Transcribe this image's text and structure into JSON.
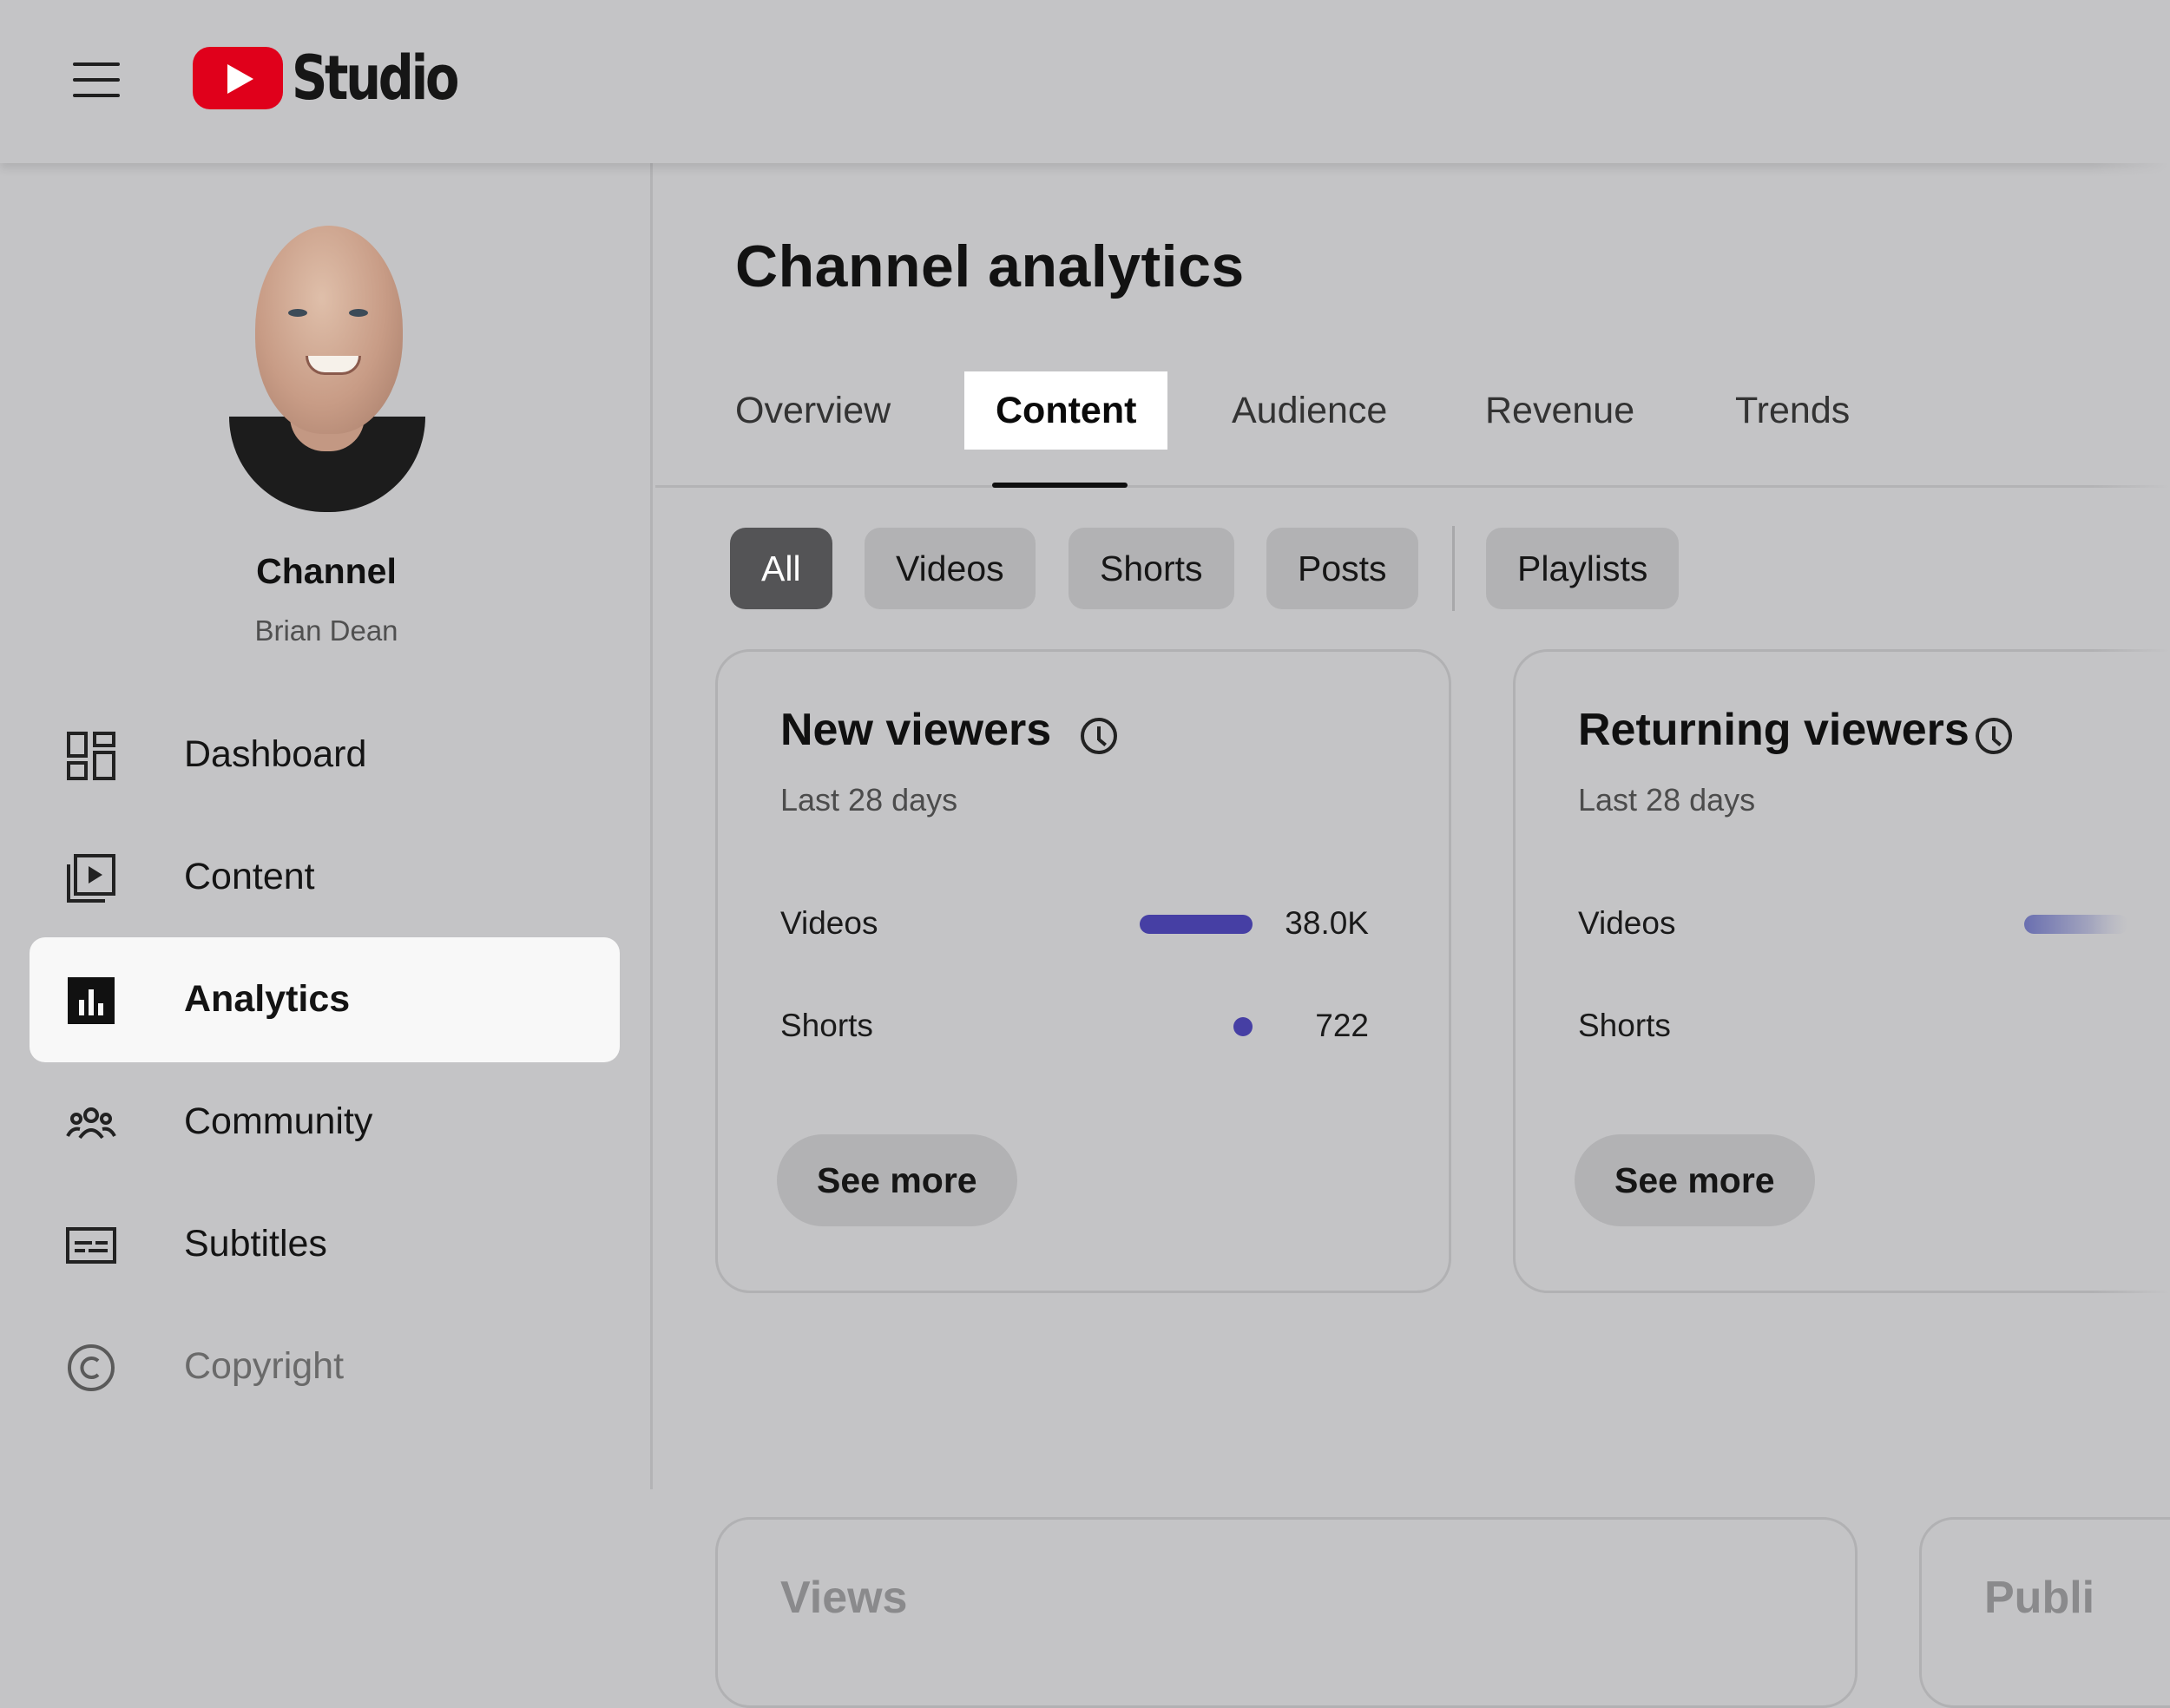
{
  "header": {
    "logo_text": "Studio",
    "logo_icon": "youtube-play-icon",
    "menu_icon": "hamburger-icon"
  },
  "sidebar": {
    "channel_title": "Channel",
    "channel_name": "Brian Dean",
    "items": [
      {
        "label": "Dashboard",
        "icon": "dashboard-icon"
      },
      {
        "label": "Content",
        "icon": "content-icon"
      },
      {
        "label": "Analytics",
        "icon": "analytics-icon",
        "active": true
      },
      {
        "label": "Community",
        "icon": "community-icon"
      },
      {
        "label": "Subtitles",
        "icon": "subtitles-icon"
      },
      {
        "label": "Copyright",
        "icon": "copyright-icon"
      }
    ]
  },
  "main": {
    "title": "Channel analytics",
    "tabs": [
      {
        "label": "Overview"
      },
      {
        "label": "Content",
        "active": true
      },
      {
        "label": "Audience"
      },
      {
        "label": "Revenue"
      },
      {
        "label": "Trends"
      }
    ],
    "chips": [
      {
        "label": "All",
        "active": true
      },
      {
        "label": "Videos"
      },
      {
        "label": "Shorts"
      },
      {
        "label": "Posts"
      },
      {
        "label": "Playlists"
      }
    ],
    "cards": [
      {
        "title": "New viewers",
        "subtitle": "Last 28 days",
        "rows": [
          {
            "label": "Videos",
            "value": "38.0K"
          },
          {
            "label": "Shorts",
            "value": "722"
          }
        ],
        "see_more": "See more"
      },
      {
        "title": "Returning viewers",
        "subtitle": "Last 28 days",
        "rows": [
          {
            "label": "Videos"
          },
          {
            "label": "Shorts"
          }
        ],
        "see_more": "See more"
      }
    ],
    "lower_cards": [
      {
        "title": "Views"
      },
      {
        "title": "Publi"
      }
    ]
  },
  "colors": {
    "background": "#c4c4c6",
    "accent_bar": "#463fa4",
    "logo_red": "#e0001b",
    "active_chip": "#545456"
  }
}
